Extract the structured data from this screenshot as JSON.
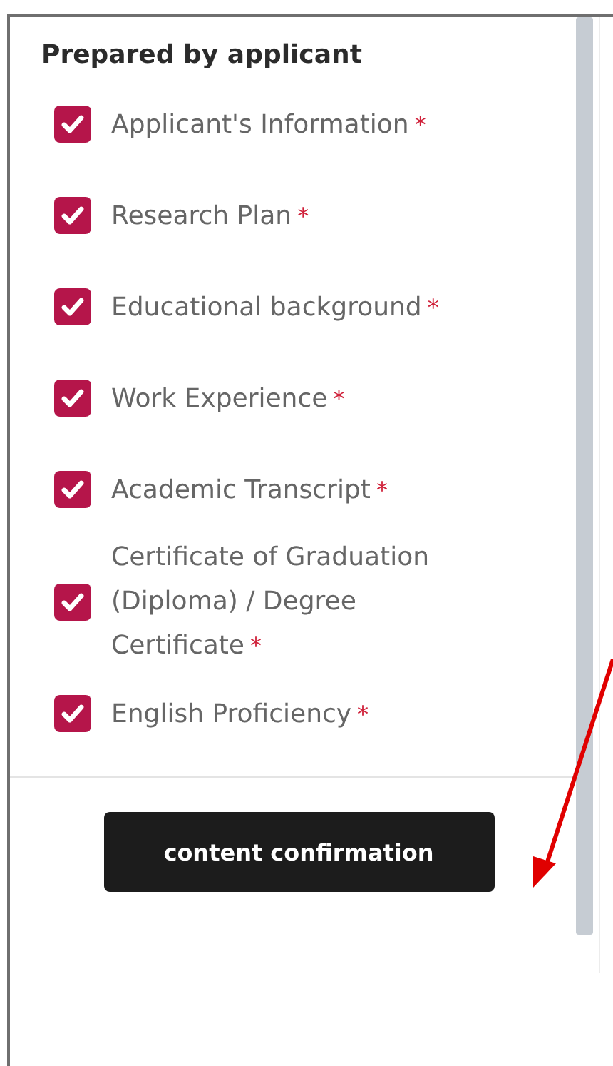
{
  "section_title": "Prepared by applicant",
  "items": [
    {
      "label": "Applicant's Information",
      "required_mark": "*",
      "checked": true
    },
    {
      "label": "Research Plan",
      "required_mark": "*",
      "checked": true
    },
    {
      "label": "Educational background",
      "required_mark": "*",
      "checked": true
    },
    {
      "label": "Work Experience",
      "required_mark": "*",
      "checked": true
    },
    {
      "label": "Academic Transcript",
      "required_mark": "*",
      "checked": true
    },
    {
      "label": "Certificate of Graduation (Diploma) / Degree Certificate",
      "required_mark": "*",
      "checked": true
    },
    {
      "label": "English Proficiency",
      "required_mark": "*",
      "checked": true
    }
  ],
  "button": {
    "label": "content confirmation"
  }
}
